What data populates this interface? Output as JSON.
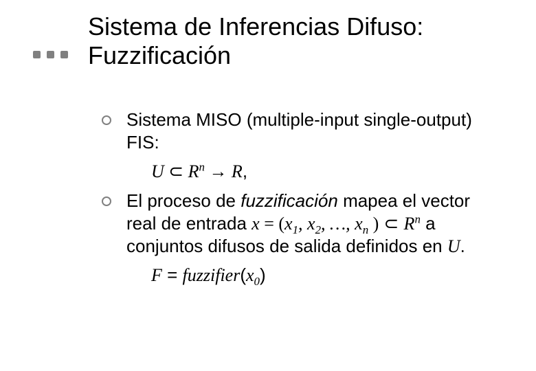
{
  "title": {
    "line1": "Sistema de Inferencias Difuso:",
    "line2": "Fuzzificación"
  },
  "bullets": {
    "item1": {
      "text_a": "Sistema MISO (multiple-input single-output) FIS:",
      "formula": {
        "U": "U",
        "subset": "⊂",
        "R1": "R",
        "n1": "n",
        "arrow": "→",
        "R2": "R",
        "comma": ","
      }
    },
    "item2": {
      "t1": "El proceso de ",
      "t2_emph": "fuzzificación",
      "t3": " mapea el vector real de entrada ",
      "x": "x",
      "eq1": " = (",
      "x1": "x",
      "s1": "1",
      "c1": ", ",
      "x2": "x",
      "s2": "2",
      "c2": ", …, ",
      "xn": "x",
      "sn": "n",
      "close": " )",
      "subset": " ⊂ ",
      "R": "R",
      "nexp": "n",
      "t4": " a conjuntos difusos de salida definidos en ",
      "Uend": "U",
      "period": ".",
      "formula": {
        "F": "F",
        "eq": " = ",
        "fuzz": "fuzzifier",
        "open": "(",
        "x0": "x",
        "s0": "0",
        "close": ")"
      }
    }
  }
}
